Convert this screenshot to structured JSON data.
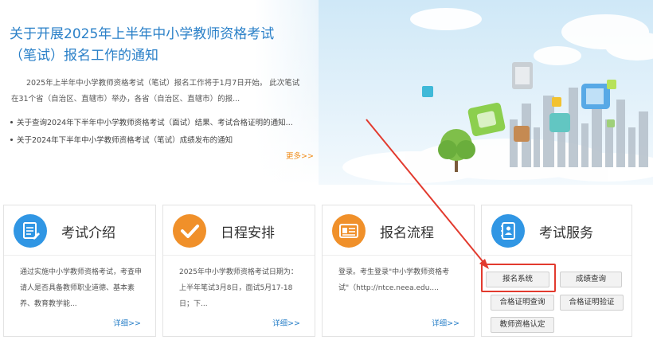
{
  "news": {
    "title": "关于开展2025年上半年中小学教师资格考试（笔试）报名工作的通知",
    "summary": "2025年上半年中小学教师资格考试（笔试）报名工作将于1月7日开始。 此次笔试在31个省（自治区、直辖市）举办，各省（自治区、直辖市）的报...",
    "items": [
      "关于查询2024年下半年中小学教师资格考试（面试）结果、考试合格证明的通知...",
      "关于2024年下半年中小学教师资格考试（笔试）成绩发布的通知"
    ],
    "more": "更多>>"
  },
  "cards": [
    {
      "title": "考试介绍",
      "icon": "document-icon",
      "body": "通过实施中小学教师资格考试，考查申请人是否具备教师职业道德、基本素养、教育教学能...",
      "detail": "详细>>"
    },
    {
      "title": "日程安排",
      "icon": "checkmark-icon",
      "body": "2025年中小学教师资格考试日期为：上半年笔试3月8日，面试5月17-18日；下...",
      "detail": "详细>>"
    },
    {
      "title": "报名流程",
      "icon": "id-card-icon",
      "body": "登录。考生登录\"中小学教师资格考试\"（http://ntce.neea.edu....",
      "detail": "详细>>"
    },
    {
      "title": "考试服务",
      "icon": "contact-book-icon"
    }
  ],
  "services": {
    "registration": "报名系统",
    "score_query": "成绩查询",
    "cert_query": "合格证明查询",
    "cert_verify": "合格证明验证",
    "teacher_cert": "教师资格认定"
  },
  "colors": {
    "title_blue": "#2a80c8",
    "more_orange": "#f08c1a",
    "icon_blue": "#3096e4",
    "icon_orange": "#f0902a",
    "highlight_red": "#e23a2e"
  }
}
